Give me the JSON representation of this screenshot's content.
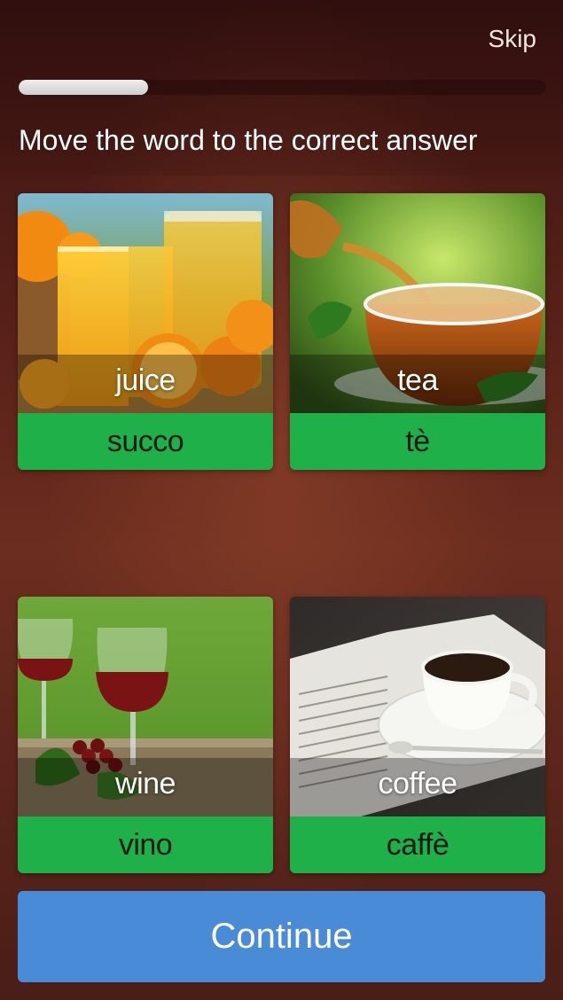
{
  "header": {
    "skip_label": "Skip",
    "progress_fraction": 0.245,
    "instruction": "Move the word to the correct answer"
  },
  "cards": [
    {
      "word": "juice",
      "answer": "succo",
      "image": "orange-juice-photo"
    },
    {
      "word": "tea",
      "answer": "tè",
      "image": "tea-cup-photo"
    },
    {
      "word": "wine",
      "answer": "vino",
      "image": "red-wine-photo"
    },
    {
      "word": "coffee",
      "answer": "caffè",
      "image": "coffee-cup-photo"
    }
  ],
  "continue_label": "Continue",
  "colors": {
    "answer_green": "#1fb04a",
    "continue_blue": "#4a8bd8",
    "background": "#5a2219"
  }
}
